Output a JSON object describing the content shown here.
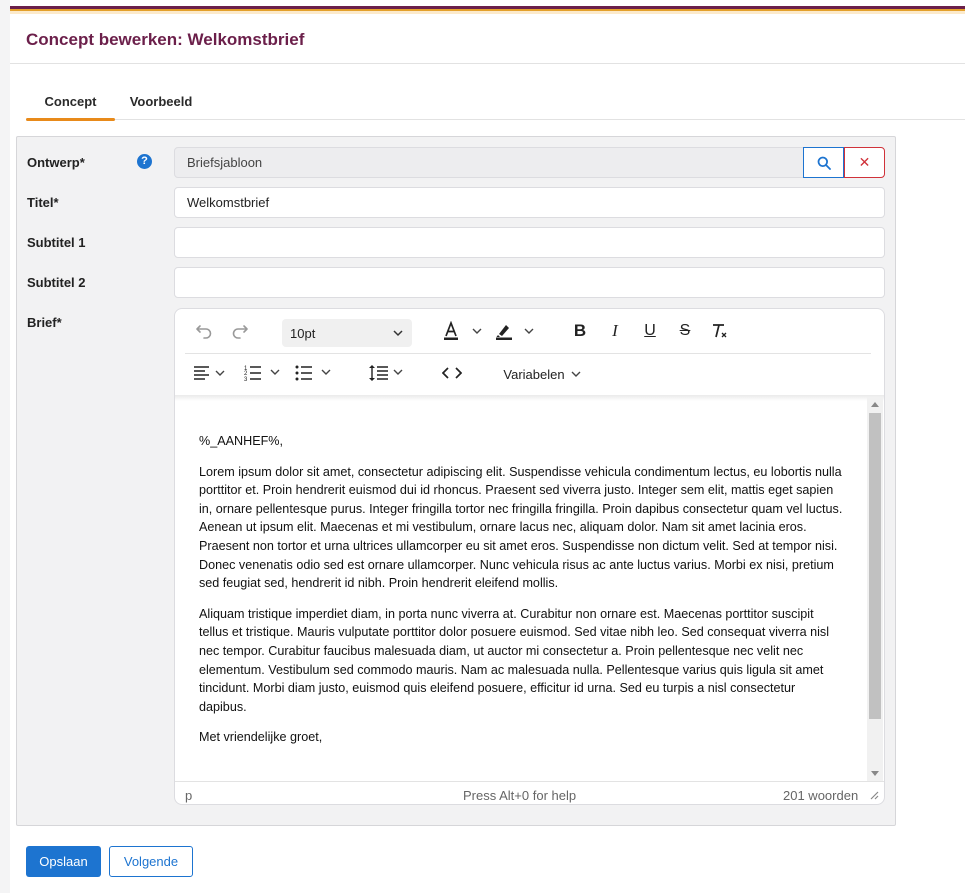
{
  "page": {
    "title": "Concept bewerken: Welkomstbrief"
  },
  "tabs": [
    {
      "label": "Concept"
    },
    {
      "label": "Voorbeeld"
    }
  ],
  "form": {
    "ontwerp_label": "Ontwerp*",
    "ontwerp_value": "Briefsjabloon",
    "help_icon": "?",
    "clear_icon": "✕",
    "titel_label": "Titel*",
    "titel_value": "Welkomstbrief",
    "subtitel1_label": "Subtitel 1",
    "subtitel1_value": "",
    "subtitel2_label": "Subtitel 2",
    "subtitel2_value": "",
    "brief_label": "Brief*"
  },
  "editor": {
    "font_size": "10pt",
    "variables_label": "Variabelen",
    "paragraphs": [
      "%_AANHEF%,",
      "Lorem ipsum dolor sit amet, consectetur adipiscing elit. Suspendisse vehicula condimentum lectus, eu lobortis nulla porttitor et. Proin hendrerit euismod dui id rhoncus. Praesent sed viverra justo. Integer sem elit, mattis eget sapien in, ornare pellentesque purus. Integer fringilla tortor nec fringilla fringilla. Proin dapibus consectetur quam vel luctus. Aenean ut ipsum elit. Maecenas et mi vestibulum, ornare lacus nec, aliquam dolor. Nam sit amet lacinia eros. Praesent non tortor et urna ultrices ullamcorper eu sit amet eros. Suspendisse non dictum velit. Sed at tempor nisi. Donec venenatis odio sed est ornare ullamcorper. Nunc vehicula risus ac ante luctus varius. Morbi ex nisi, pretium sed feugiat sed, hendrerit id nibh. Proin hendrerit eleifend mollis.",
      "Aliquam tristique imperdiet diam, in porta nunc viverra at. Curabitur non ornare est. Maecenas porttitor suscipit tellus et tristique. Mauris vulputate porttitor dolor posuere euismod. Sed vitae nibh leo. Sed consequat viverra nisl nec tempor. Curabitur faucibus malesuada diam, ut auctor mi consectetur a. Proin pellentesque nec velit nec elementum. Vestibulum sed commodo mauris. Nam ac malesuada nulla. Pellentesque varius quis ligula sit amet tincidunt. Morbi diam justo, euismod quis eleifend posuere, efficitur id urna. Sed eu turpis a nisl consectetur dapibus.",
      "Met vriendelijke groet,"
    ],
    "status_path": "p",
    "status_help": "Press Alt+0 for help",
    "status_words": "201 woorden"
  },
  "actions": {
    "save_label": "Opslaan",
    "next_label": "Volgende"
  },
  "colors": {
    "brand": "#6b1f4a",
    "accent": "#e88a1a",
    "primary": "#1d74d0",
    "danger": "#d0323a"
  },
  "icons": [
    "undo-icon",
    "redo-icon",
    "chevron-down-icon",
    "text-color-icon",
    "highlight-icon",
    "bold-icon",
    "italic-icon",
    "underline-icon",
    "strikethrough-icon",
    "clear-formatting-icon",
    "align-left-icon",
    "numbered-list-icon",
    "bulleted-list-icon",
    "line-height-icon",
    "source-code-icon",
    "search-icon",
    "close-icon",
    "help-icon",
    "resize-grip-icon"
  ]
}
